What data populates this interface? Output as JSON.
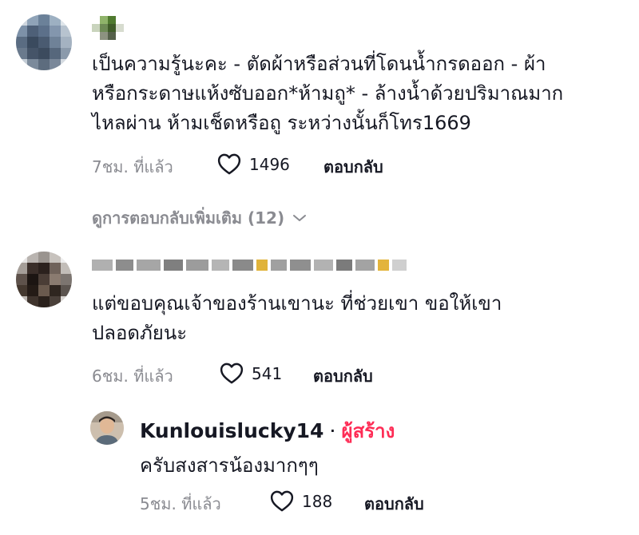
{
  "comments": [
    {
      "text": "เป็นความรู้นะคะ - ตัดผ้าหรือส่วนที่โดนน้ำกรดออก - ผ้าหรือกระดาษแห้งซับออก*ห้ามถู* - ล้างน้ำด้วยปริมาณมากไหลผ่าน ห้ามเช็ดหรือถู ระหว่างนั้นก็โทร1669",
      "lines": [
        "เป็นความรู้นะคะ - ตัดผ้าหรือส่วนที่โดนน้ำกรดออก - ผ้า",
        "หรือกระดาษแห้งซับออก*ห้ามถู* - ล้างน้ำด้วยปริมาณมาก",
        "ไหลผ่าน ห้ามเช็ดหรือถู ระหว่างนั้นก็โทร1669"
      ],
      "time": "7ชม. ที่แล้ว",
      "likes": "1496",
      "reply_label": "ตอบกลับ",
      "view_replies": "ดูการตอบกลับเพิ่มเติม (12)"
    },
    {
      "lines": [
        "แต่ขอบคุณเจ้าของร้านเขานะ ที่ช่วยเขา ขอให้เขา",
        "ปลอดภัยนะ"
      ],
      "time": "6ชม. ที่แล้ว",
      "likes": "541",
      "reply_label": "ตอบกลับ"
    }
  ],
  "reply": {
    "username": "Kunlouislucky14",
    "separator": "·",
    "badge": "ผู้สร้าง",
    "text": "ครับสงสารน้องมากๆๆ",
    "time": "5ชม. ที่แล้ว",
    "likes": "188",
    "reply_label": "ตอบกลับ"
  },
  "icons": {
    "like": "heart-outline-icon",
    "expand": "chevron-down-icon"
  },
  "colors": {
    "text": "#161823",
    "muted": "#8a8b91",
    "creator_badge": "#fe2c55"
  }
}
